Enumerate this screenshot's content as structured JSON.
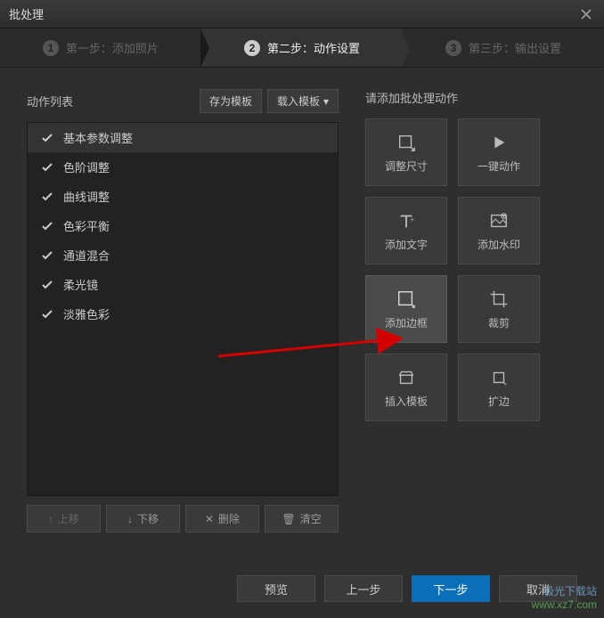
{
  "title": "批处理",
  "steps": [
    {
      "num": "1",
      "label": "第一步：添加照片",
      "active": false
    },
    {
      "num": "2",
      "label": "第二步：动作设置",
      "active": true
    },
    {
      "num": "3",
      "label": "第三步：输出设置",
      "active": false
    }
  ],
  "left": {
    "title": "动作列表",
    "save_template": "存为模板",
    "load_template": "载入模板",
    "items": [
      "基本参数调整",
      "色阶调整",
      "曲线调整",
      "色彩平衡",
      "通道混合",
      "柔光镜",
      "淡雅色彩"
    ],
    "controls": {
      "move_up": "上移",
      "move_down": "下移",
      "delete": "删除",
      "clear": "清空"
    }
  },
  "right": {
    "title": "请添加批处理动作",
    "buttons": [
      {
        "id": "resize",
        "label": "调整尺寸"
      },
      {
        "id": "one-click",
        "label": "一键动作"
      },
      {
        "id": "add-text",
        "label": "添加文字"
      },
      {
        "id": "add-watermark",
        "label": "添加水印"
      },
      {
        "id": "add-border",
        "label": "添加边框"
      },
      {
        "id": "crop",
        "label": "裁剪"
      },
      {
        "id": "insert-template",
        "label": "插入模板"
      },
      {
        "id": "expand",
        "label": "扩边"
      }
    ]
  },
  "footer": {
    "preview": "预览",
    "prev": "上一步",
    "next": "下一步",
    "cancel": "取消"
  },
  "watermark": {
    "line1": "极光下载站",
    "line2": "www.xz7.com"
  }
}
